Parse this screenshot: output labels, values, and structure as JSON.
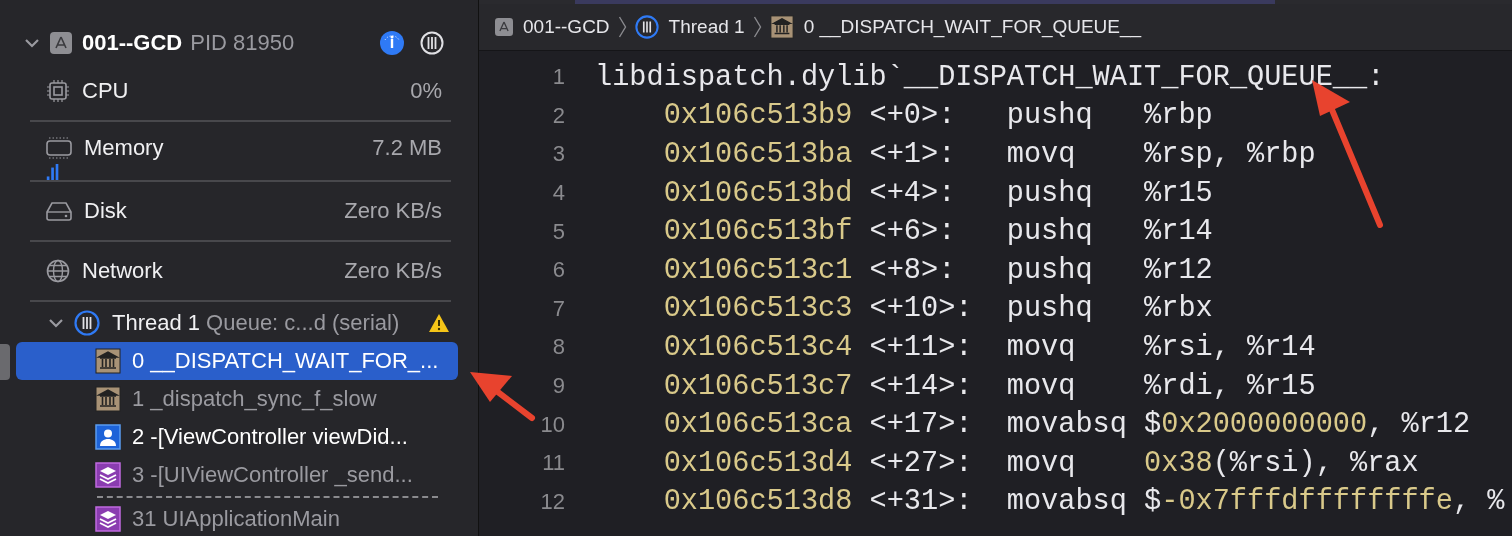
{
  "process": {
    "name": "001--GCD",
    "pid": "PID 81950",
    "expanded": true
  },
  "gauges": [
    {
      "kind": "cpu",
      "label": "CPU",
      "value": "0%"
    },
    {
      "kind": "memory",
      "label": "Memory",
      "value": "7.2 MB"
    },
    {
      "kind": "disk",
      "label": "Disk",
      "value": "Zero KB/s"
    },
    {
      "kind": "network",
      "label": "Network",
      "value": "Zero KB/s"
    }
  ],
  "thread": {
    "name": "Thread 1",
    "queue": "Queue: c...d (serial)",
    "expanded": true,
    "warning": true
  },
  "frame_groups": [
    [
      {
        "text": "0 __DISPATCH_WAIT_FOR_...",
        "kind": "system",
        "selected": true
      },
      {
        "text": "1 _dispatch_sync_f_slow",
        "kind": "system",
        "selected": false
      },
      {
        "text": "2 -[ViewController viewDid...",
        "kind": "user",
        "selected": false
      },
      {
        "text": "3 -[UIViewController _send...",
        "kind": "framework",
        "selected": false
      }
    ],
    [
      {
        "text": "31 UIApplicationMain",
        "kind": "framework",
        "selected": false
      }
    ]
  ],
  "breadcrumb": [
    {
      "kind": "app",
      "text": "001--GCD"
    },
    {
      "kind": "thread",
      "text": "Thread 1"
    },
    {
      "kind": "system",
      "text": "0 __DISPATCH_WAIT_FOR_QUEUE__"
    }
  ],
  "code": [
    {
      "no": "1",
      "header": "libdispatch.dylib`__DISPATCH_WAIT_FOR_QUEUE__:"
    },
    {
      "no": "2",
      "addr": "0x106c513b9",
      "offset": "<+0>:",
      "op": "pushq",
      "args": [
        {
          "text": "%rbp",
          "kind": "plain"
        }
      ]
    },
    {
      "no": "3",
      "addr": "0x106c513ba",
      "offset": "<+1>:",
      "op": "movq",
      "args": [
        {
          "text": "%rsp, %rbp",
          "kind": "plain"
        }
      ]
    },
    {
      "no": "4",
      "addr": "0x106c513bd",
      "offset": "<+4>:",
      "op": "pushq",
      "args": [
        {
          "text": "%r15",
          "kind": "plain"
        }
      ]
    },
    {
      "no": "5",
      "addr": "0x106c513bf",
      "offset": "<+6>:",
      "op": "pushq",
      "args": [
        {
          "text": "%r14",
          "kind": "plain"
        }
      ]
    },
    {
      "no": "6",
      "addr": "0x106c513c1",
      "offset": "<+8>:",
      "op": "pushq",
      "args": [
        {
          "text": "%r12",
          "kind": "plain"
        }
      ]
    },
    {
      "no": "7",
      "addr": "0x106c513c3",
      "offset": "<+10>:",
      "op": "pushq",
      "args": [
        {
          "text": "%rbx",
          "kind": "plain"
        }
      ]
    },
    {
      "no": "8",
      "addr": "0x106c513c4",
      "offset": "<+11>:",
      "op": "movq",
      "args": [
        {
          "text": "%rsi, %r14",
          "kind": "plain"
        }
      ]
    },
    {
      "no": "9",
      "addr": "0x106c513c7",
      "offset": "<+14>:",
      "op": "movq",
      "args": [
        {
          "text": "%rdi, %r15",
          "kind": "plain"
        }
      ]
    },
    {
      "no": "10",
      "addr": "0x106c513ca",
      "offset": "<+17>:",
      "op": "movabsq",
      "args": [
        {
          "text": "$",
          "kind": "plain"
        },
        {
          "text": "0x2000000000",
          "kind": "number"
        },
        {
          "text": ", %r12",
          "kind": "plain"
        }
      ]
    },
    {
      "no": "11",
      "addr": "0x106c513d4",
      "offset": "<+27>:",
      "op": "movq",
      "args": [
        {
          "text": "0x38",
          "kind": "number"
        },
        {
          "text": "(%rsi), %rax",
          "kind": "plain"
        }
      ]
    },
    {
      "no": "12",
      "addr": "0x106c513d8",
      "offset": "<+31>:",
      "op": "movabsq",
      "args": [
        {
          "text": "$",
          "kind": "plain"
        },
        {
          "text": "-0x7fffdffffffffe",
          "kind": "number"
        },
        {
          "text": ", %",
          "kind": "plain"
        }
      ]
    }
  ]
}
